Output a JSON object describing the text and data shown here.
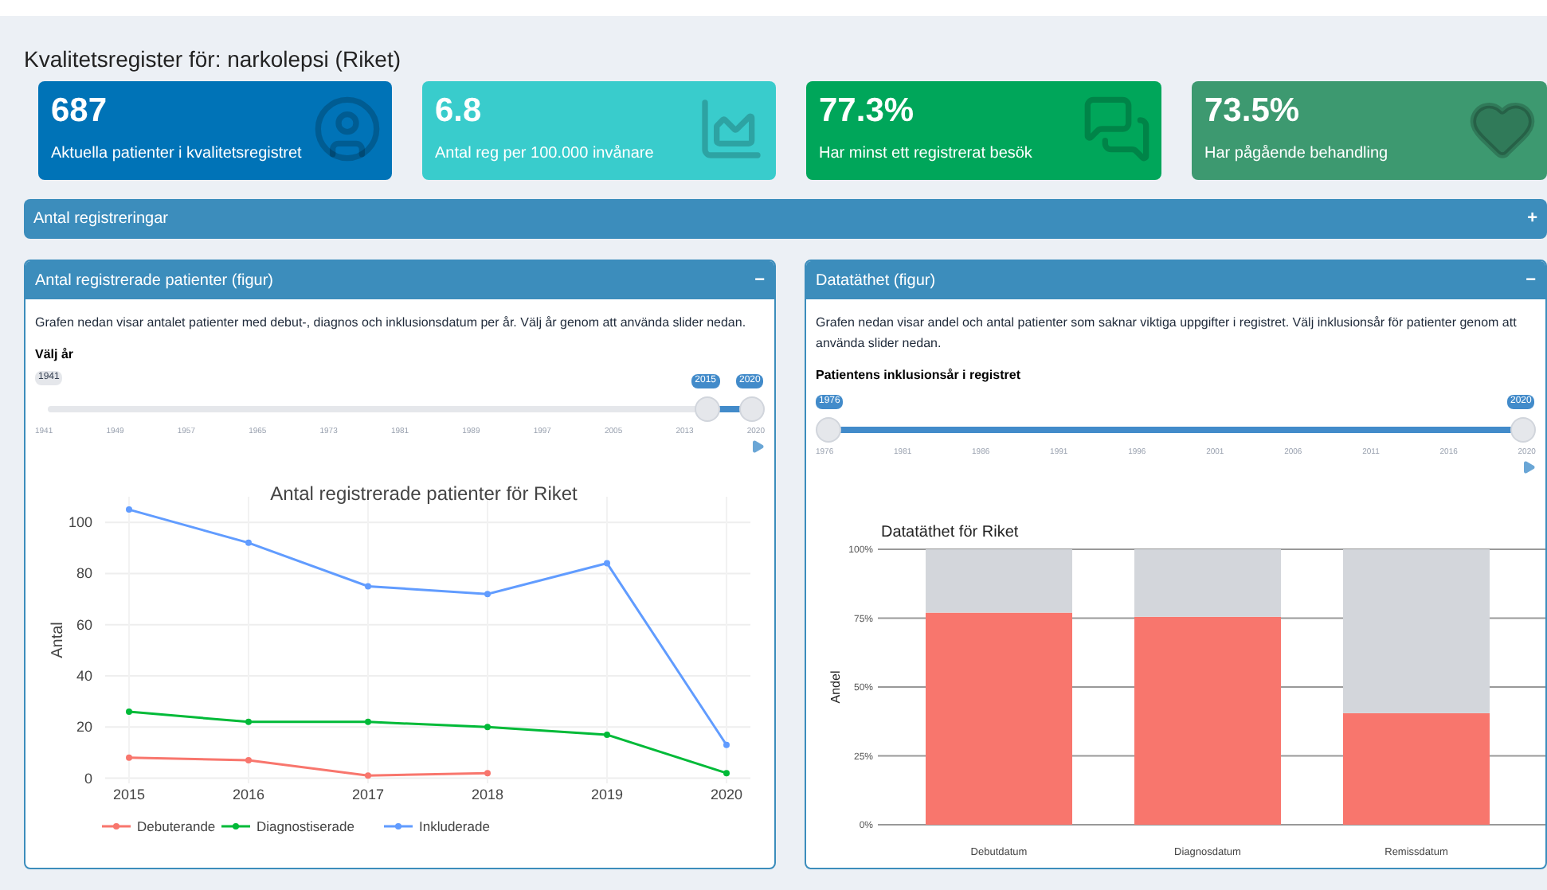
{
  "page_title": "Kvalitetsregister för: narkolepsi (Riket)",
  "value_boxes": [
    {
      "value": "687",
      "label": "Aktuella patienter i kvalitetsregistret",
      "color": "#0073b7",
      "kind": "user"
    },
    {
      "value": "6.8",
      "label": "Antal reg per 100.000 invånare",
      "color": "#39cccc",
      "kind": "area"
    },
    {
      "value": "77.3%",
      "label": "Har minst ett registrerat besök",
      "color": "#00a65a",
      "kind": "comments"
    },
    {
      "value": "73.5%",
      "label": "Har pågående behandling",
      "color": "#3d9970",
      "kind": "heart"
    }
  ],
  "collapsed_box": {
    "title": "Antal registreringar",
    "toggle": "+"
  },
  "left_panel": {
    "title": "Antal registrerade patienter (figur)",
    "toggle": "−",
    "description": "Grafen nedan visar antalet patienter med debut-, diagnos och inklusionsdatum per år. Välj år genom att använda slider nedan.",
    "slider": {
      "label": "Välj år",
      "min_label": "1941",
      "thumbs": [
        "2015",
        "2020"
      ],
      "ticks": [
        "1941",
        "1949",
        "1957",
        "1965",
        "1973",
        "1981",
        "1989",
        "1997",
        "2005",
        "2013",
        "2020"
      ]
    },
    "chart_data": {
      "type": "line",
      "title": "Antal registrerade patienter för Riket",
      "ylabel": "Antal",
      "grid": true,
      "legend": "bottom",
      "x": [
        2015,
        2016,
        2017,
        2018,
        2019,
        2020
      ],
      "xlim": [
        2014.8,
        2020.2
      ],
      "ylim": [
        -2,
        110
      ],
      "yticks": [
        0,
        20,
        40,
        60,
        80,
        100
      ],
      "xticks": [
        2015,
        2016,
        2017,
        2018,
        2019,
        2020
      ],
      "series": [
        {
          "name": "Debuterande",
          "color": "#f8766d",
          "marker": "circle",
          "values": [
            8,
            7,
            1,
            2,
            null,
            null
          ]
        },
        {
          "name": "Diagnostiserade",
          "color": "#00ba38",
          "marker": "circle",
          "values": [
            26,
            22,
            22,
            20,
            17,
            2
          ]
        },
        {
          "name": "Inkluderade",
          "color": "#619cff",
          "marker": "circle",
          "values": [
            105,
            92,
            75,
            72,
            84,
            13
          ]
        }
      ]
    }
  },
  "right_panel": {
    "title": "Datatäthet (figur)",
    "toggle": "−",
    "description": "Grafen nedan visar andel och antal patienter som saknar viktiga uppgifter i registret. Välj inklusionsår för patienter genom att använda slider nedan.",
    "slider": {
      "label": "Patientens inklusionsår i registret",
      "thumbs": [
        "1976",
        "2020"
      ],
      "ticks": [
        "1976",
        "1981",
        "1986",
        "1991",
        "1996",
        "2001",
        "2006",
        "2011",
        "2016",
        "2020"
      ]
    },
    "chart_data": {
      "type": "bar",
      "title": "Datatäthet för Riket",
      "ylabel": "Andel",
      "stacked": true,
      "grid": true,
      "categories": [
        "Debutdatum",
        "Diagnosdatum",
        "Remissdatum"
      ],
      "ylim": [
        0,
        1
      ],
      "yticks": [
        {
          "value": 0,
          "label": "0%"
        },
        {
          "value": 0.25,
          "label": "25%"
        },
        {
          "value": 0.5,
          "label": "50%"
        },
        {
          "value": 0.75,
          "label": "75%"
        },
        {
          "value": 1,
          "label": "100%"
        }
      ],
      "series": [
        {
          "color": "#f8766d",
          "values": [
            0.77,
            0.755,
            0.405
          ]
        },
        {
          "color": "#d3d6db",
          "values": [
            0.23,
            0.245,
            0.595
          ]
        }
      ]
    }
  }
}
